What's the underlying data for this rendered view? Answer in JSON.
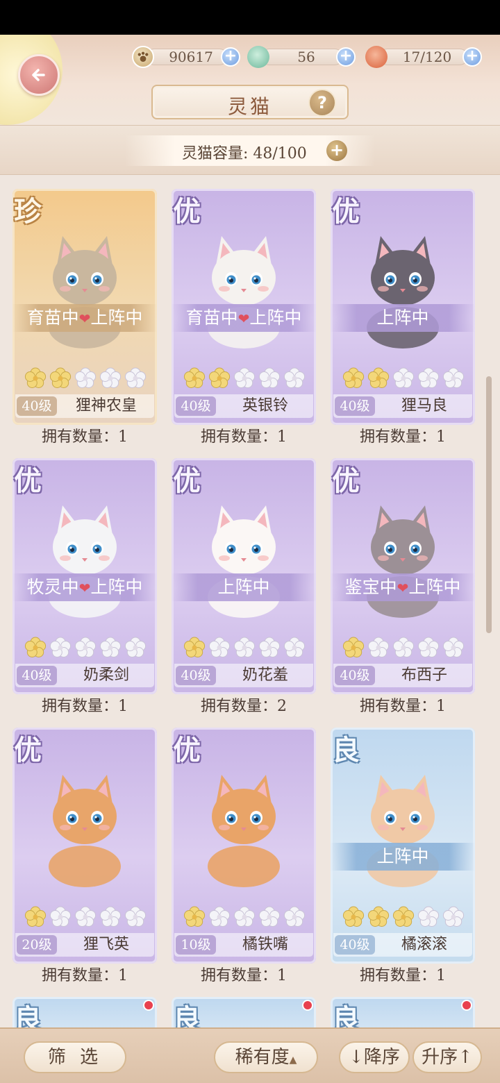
{
  "header": {
    "title": "灵猫",
    "help_label": "?",
    "resources": [
      {
        "name": "paw-coin",
        "value": "90617",
        "icon": "paw-icon"
      },
      {
        "name": "jade",
        "value": "56",
        "icon": "jade-bird-icon"
      },
      {
        "name": "food",
        "value": "17/120",
        "icon": "meat-bun-icon"
      }
    ]
  },
  "capacity": {
    "text": "灵猫容量: 48/100"
  },
  "cards": [
    {
      "rarity": "珍",
      "theme": "gold",
      "status": [
        "育苗中",
        "上阵中"
      ],
      "stars": 2,
      "level": "40级",
      "name": "狸神农皇",
      "count": "拥有数量：1"
    },
    {
      "rarity": "优",
      "theme": "purple",
      "status": [
        "育苗中",
        "上阵中"
      ],
      "stars": 2,
      "level": "40级",
      "name": "英银铃",
      "count": "拥有数量：1"
    },
    {
      "rarity": "优",
      "theme": "purple",
      "status": [
        "上阵中"
      ],
      "stars": 2,
      "level": "40级",
      "name": "狸马良",
      "count": "拥有数量：1"
    },
    {
      "rarity": "优",
      "theme": "purple",
      "status": [
        "牧灵中",
        "上阵中"
      ],
      "stars": 1,
      "level": "40级",
      "name": "奶柔剑",
      "count": "拥有数量：1"
    },
    {
      "rarity": "优",
      "theme": "purple",
      "status": [
        "上阵中"
      ],
      "stars": 1,
      "level": "40级",
      "name": "奶花羞",
      "count": "拥有数量：2"
    },
    {
      "rarity": "优",
      "theme": "purple",
      "status": [
        "鉴宝中",
        "上阵中"
      ],
      "stars": 1,
      "level": "40级",
      "name": "布西子",
      "count": "拥有数量：1"
    },
    {
      "rarity": "优",
      "theme": "purple",
      "status": [],
      "stars": 1,
      "level": "20级",
      "name": "狸飞英",
      "count": "拥有数量：1"
    },
    {
      "rarity": "优",
      "theme": "purple",
      "status": [],
      "stars": 1,
      "level": "10级",
      "name": "橘铁嘴",
      "count": "拥有数量：1"
    },
    {
      "rarity": "良",
      "theme": "blue",
      "status": [
        "上阵中"
      ],
      "stars": 3,
      "level": "40级",
      "name": "橘滚滚",
      "count": "拥有数量：1"
    }
  ],
  "partial_cards": [
    {
      "rarity": "良"
    },
    {
      "rarity": "良"
    },
    {
      "rarity": "良"
    }
  ],
  "bottom": {
    "filter_label": "筛 选",
    "sort_label": "稀有度",
    "desc_label": "↓降序",
    "asc_label": "升序↑"
  },
  "colors": {
    "star_filled": "#f3d77a",
    "star_empty": "#f4f4f8",
    "heart": "#e0505c",
    "plus_blue": "#6f9de0"
  }
}
